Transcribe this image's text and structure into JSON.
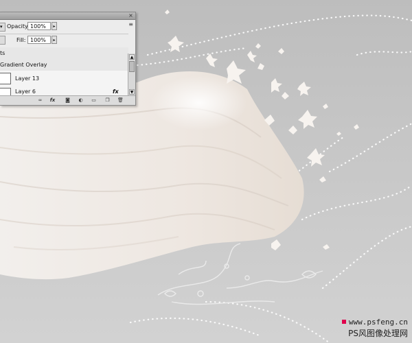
{
  "colors": {
    "canvas_top": "#bdbdbd",
    "canvas_bottom": "#d2d2d2",
    "fabric": "#f3eeea",
    "watermark_dot": "#e0004c"
  },
  "layers_panel": {
    "close_glyph": "×",
    "menu_glyph": "≡",
    "opacity_label": "Opacity:",
    "opacity_value": "100%",
    "fill_label": "Fill:",
    "fill_value": "100%",
    "effects_label": "ts",
    "gradient_overlay_label": "Gradient Overlay",
    "layers": [
      {
        "name": "Layer 13"
      },
      {
        "name": "Layer 6"
      }
    ],
    "fx_label": "fx",
    "toolbar_icons": [
      "link-icon",
      "fx-icon",
      "mask-icon",
      "adjustment-icon",
      "group-icon",
      "new-layer-icon",
      "trash-icon"
    ],
    "toolbar_glyphs": [
      "∞",
      "fx",
      "◙",
      "◐",
      "▭",
      "❐",
      "🗑"
    ]
  },
  "watermark": {
    "url": "www.psfeng.cn",
    "text_cn": "PS风图像处理网"
  }
}
